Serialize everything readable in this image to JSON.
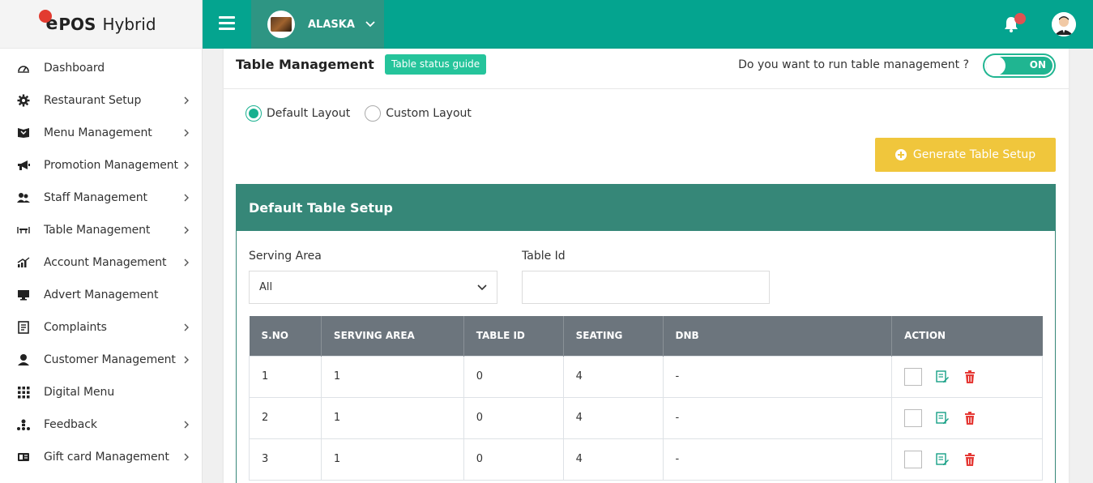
{
  "brand": {
    "e": "e",
    "pos": "POS",
    "hybrid": "Hybrid"
  },
  "sidebar": {
    "items": [
      {
        "label": "Dashboard",
        "icon": "dashboard-icon",
        "has_submenu": false
      },
      {
        "label": "Restaurant Setup",
        "icon": "gear-icon",
        "has_submenu": true
      },
      {
        "label": "Menu Management",
        "icon": "menu-book-icon",
        "has_submenu": true
      },
      {
        "label": "Promotion Management",
        "icon": "megaphone-icon",
        "has_submenu": true
      },
      {
        "label": "Staff Management",
        "icon": "staff-icon",
        "has_submenu": true
      },
      {
        "label": "Table Management",
        "icon": "table-icon",
        "has_submenu": true
      },
      {
        "label": "Account Management",
        "icon": "chart-icon",
        "has_submenu": true
      },
      {
        "label": "Advert Management",
        "icon": "monitor-icon",
        "has_submenu": false
      },
      {
        "label": "Complaints",
        "icon": "document-icon",
        "has_submenu": true
      },
      {
        "label": "Customer Management",
        "icon": "customer-icon",
        "has_submenu": true
      },
      {
        "label": "Digital Menu",
        "icon": "grid-icon",
        "has_submenu": false
      },
      {
        "label": "Feedback",
        "icon": "feedback-icon",
        "has_submenu": true
      },
      {
        "label": "Gift card Management",
        "icon": "gift-card-icon",
        "has_submenu": true
      }
    ]
  },
  "topbar": {
    "store_name": "ALASKA",
    "accent_color": "#04a48f",
    "store_bg": "#2e9583"
  },
  "page": {
    "title": "Table Management",
    "status_guide_label": "Table status guide",
    "run_question": "Do you want to run table management ?",
    "toggle_label": "ON",
    "layout_options": [
      "Default Layout",
      "Custom Layout"
    ],
    "selected_layout": "Default Layout",
    "generate_button": "Generate Table Setup"
  },
  "panel": {
    "title": "Default Table Setup",
    "serving_area_label": "Serving Area",
    "serving_area_value": "All",
    "table_id_label": "Table Id",
    "table_id_value": "",
    "columns": [
      "S.NO",
      "SERVING AREA",
      "TABLE ID",
      "SEATING",
      "DNB",
      "ACTION"
    ],
    "rows": [
      {
        "sno": "1",
        "serving_area": "1",
        "table_id": "0",
        "seating": "4",
        "dnb": "-"
      },
      {
        "sno": "2",
        "serving_area": "1",
        "table_id": "0",
        "seating": "4",
        "dnb": "-"
      },
      {
        "sno": "3",
        "serving_area": "1",
        "table_id": "0",
        "seating": "4",
        "dnb": "-"
      }
    ]
  }
}
